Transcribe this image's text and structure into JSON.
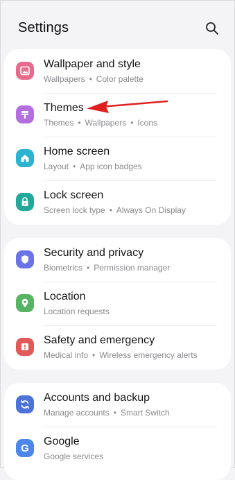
{
  "header": {
    "title": "Settings"
  },
  "groups": [
    {
      "items": [
        {
          "label": "Wallpaper and style",
          "subs": [
            "Wallpapers",
            "Color palette"
          ],
          "icon": "image-icon",
          "color": "#e96b8c"
        },
        {
          "label": "Themes",
          "subs": [
            "Themes",
            "Wallpapers",
            "Icons"
          ],
          "icon": "brush-icon",
          "color": "#b46ee0"
        },
        {
          "label": "Home screen",
          "subs": [
            "Layout",
            "App icon badges"
          ],
          "icon": "home-icon",
          "color": "#2bb3cf"
        },
        {
          "label": "Lock screen",
          "subs": [
            "Screen lock type",
            "Always On Display"
          ],
          "icon": "lock-icon",
          "color": "#23a99c"
        }
      ]
    },
    {
      "items": [
        {
          "label": "Security and privacy",
          "subs": [
            "Biometrics",
            "Permission manager"
          ],
          "icon": "shield-icon",
          "color": "#6a74e6"
        },
        {
          "label": "Location",
          "subs": [
            "Location requests"
          ],
          "icon": "location-pin-icon",
          "color": "#56b463"
        },
        {
          "label": "Safety and emergency",
          "subs": [
            "Medical info",
            "Wireless emergency alerts"
          ],
          "icon": "alert-icon",
          "color": "#e05a5a"
        }
      ]
    },
    {
      "items": [
        {
          "label": "Accounts and backup",
          "subs": [
            "Manage accounts",
            "Smart Switch"
          ],
          "icon": "sync-icon",
          "color": "#4d73d8"
        },
        {
          "label": "Google",
          "subs": [
            "Google services"
          ],
          "icon": "google-icon",
          "color": "#4d86ea"
        }
      ]
    }
  ],
  "annotation": {
    "arrow_color": "#e02020"
  }
}
